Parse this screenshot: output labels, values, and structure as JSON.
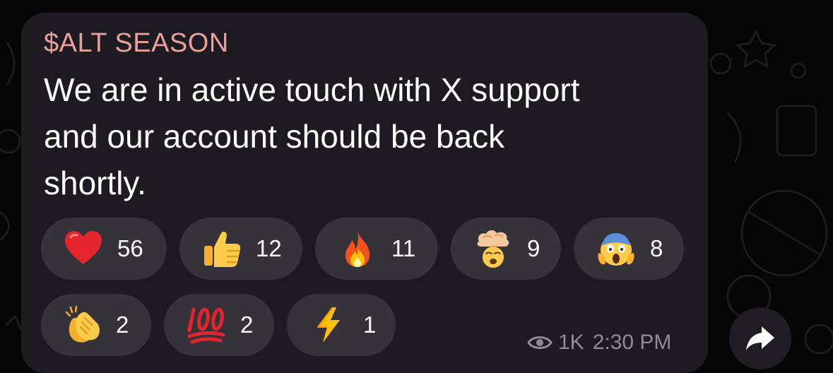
{
  "message": {
    "sender_name": "$ALT SEASON",
    "text_lines": [
      "We are in active touch with X support",
      "and our account should be back",
      "shortly."
    ]
  },
  "reactions": [
    {
      "icon": "red-heart-icon",
      "count": "56"
    },
    {
      "icon": "thumbs-up-icon",
      "count": "12"
    },
    {
      "icon": "fire-icon",
      "count": "11"
    },
    {
      "icon": "exploding-head-icon",
      "count": "9"
    },
    {
      "icon": "screaming-face-icon",
      "count": "8"
    },
    {
      "icon": "clapping-hands-icon",
      "count": "2"
    },
    {
      "icon": "hundred-points-icon",
      "count": "2"
    },
    {
      "icon": "high-voltage-icon",
      "count": "1"
    }
  ],
  "meta": {
    "views": "1K",
    "time": "2:30 PM"
  },
  "colors": {
    "background": "#060606",
    "bubble": "#1e1a22",
    "reaction_pill": "#35323a",
    "sender_name": "#e9a09a",
    "meta_text": "#8f8c94"
  }
}
